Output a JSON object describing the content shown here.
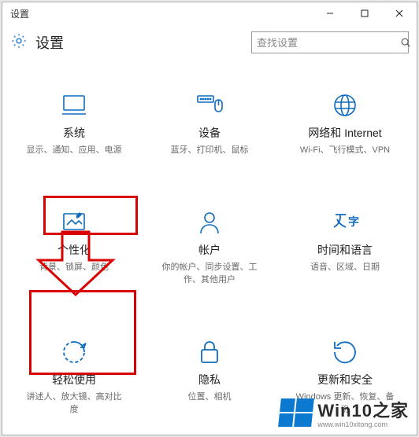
{
  "window": {
    "title": "设置"
  },
  "header": {
    "title": "设置"
  },
  "search": {
    "placeholder": "查找设置"
  },
  "tiles": {
    "system": {
      "label": "系统",
      "desc": "显示、通知、应用、电源"
    },
    "devices": {
      "label": "设备",
      "desc": "蓝牙、打印机、鼠标"
    },
    "network": {
      "label": "网络和 Internet",
      "desc": "Wi-Fi、飞行模式、VPN"
    },
    "personal": {
      "label": "个性化",
      "desc": "背景、锁屏、颜色"
    },
    "accounts": {
      "label": "帐户",
      "desc": "你的帐户、同步设置、工作、其他用户"
    },
    "time": {
      "label": "时间和语言",
      "desc": "语音、区域、日期"
    },
    "ease": {
      "label": "轻松使用",
      "desc": "讲述人、放大镜、高对比度"
    },
    "privacy": {
      "label": "隐私",
      "desc": "位置、相机"
    },
    "update": {
      "label": "更新和安全",
      "desc": "Windows 更新、恢复、备份"
    }
  },
  "watermark": {
    "main": "Win10之家",
    "sub": "www.win10xitong.com"
  }
}
